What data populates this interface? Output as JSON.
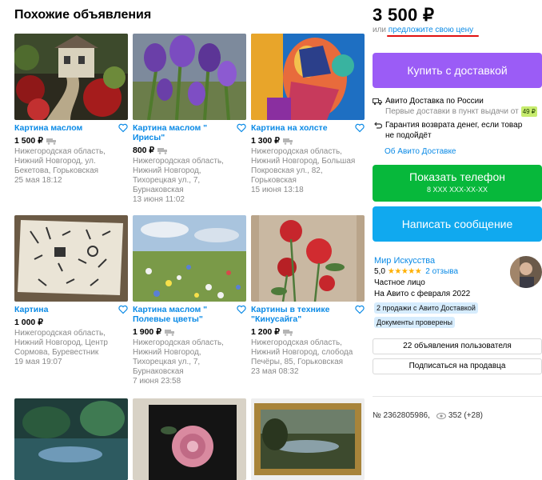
{
  "section": {
    "title": "Похожие объявления"
  },
  "listings": [
    {
      "title": "Картина маслом",
      "price": "1 500 ₽",
      "meta": "Нижегородская область, Нижний Новгород, ул. Бекетова, Горьковская",
      "date": "25 мая 18:12"
    },
    {
      "title": "Картина маслом \" Ирисы\"",
      "price": "800 ₽",
      "meta": "Нижегородская область, Нижний Новгород, Тихорецкая ул., 7, Бурнаковская",
      "date": "13 июня 11:02"
    },
    {
      "title": "Картина на холсте",
      "price": "1 300 ₽",
      "meta": "Нижегородская область, Нижний Новгород, Большая Покровская ул., 82, Горьковская",
      "date": "15 июня 13:18"
    },
    {
      "title": "Картина",
      "price": "1 000 ₽",
      "meta": "Нижегородская область, Нижний Новгород, Центр Сормова, Буревестник",
      "date": "19 мая 19:07"
    },
    {
      "title": "Картина маслом \" Полевые цветы\"",
      "price": "1 900 ₽",
      "meta": "Нижегородская область, Нижний Новгород, Тихорецкая ул., 7, Бурнаковская",
      "date": "7 июня 23:58"
    },
    {
      "title": "Картины в технике \"Кинусайга\"",
      "price": "1 200 ₽",
      "meta": "Нижегородская область, Нижний Новгород, слобода Печёры, 85, Горьковская",
      "date": "23 мая 08:32"
    }
  ],
  "product": {
    "price": "3 500 ₽",
    "offer_prefix": "или",
    "offer_link": "предложите свою цену"
  },
  "buttons": {
    "buy": "Купить с доставкой",
    "phone": "Показать телефон",
    "phone_masked": "8 XXX XXX-XX-XX",
    "message": "Написать сообщение",
    "user_listings": "22 объявления пользователя",
    "subscribe": "Подписаться на продавца"
  },
  "delivery": {
    "title": "Авито Доставка по России",
    "note": "Первые доставки в пункт выдачи от",
    "note_price": "49 ₽",
    "guarantee": "Гарантия возврата денег, если товар не подойдёт",
    "about_link": "Об Авито Доставке"
  },
  "seller": {
    "name": "Мир Искусства",
    "rating": "5,0",
    "stars": "★★★★★",
    "reviews": "2 отзыва",
    "type": "Частное лицо",
    "since": "На Авито с февраля 2022",
    "badge_sales": "2 продажи с Авито Доставкой",
    "badge_docs": "Документы проверены"
  },
  "stats": {
    "id": "№ 2362805986,",
    "views": "352 (+28)"
  },
  "colors": {
    "link": "#0a8ae6",
    "buy": "#9b5cf6",
    "phone": "#07b83b",
    "message": "#10a9ef"
  }
}
